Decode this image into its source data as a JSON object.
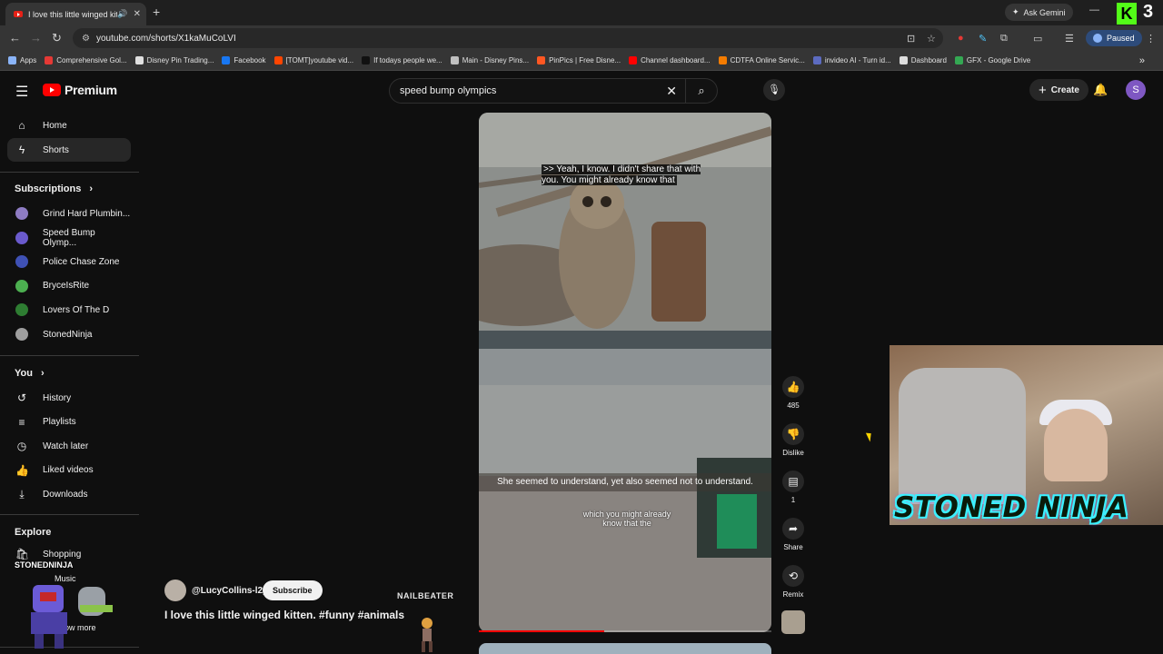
{
  "browser": {
    "tab_title": "I love this little winged kitten",
    "tab_audio_icon": "speaker-icon",
    "url": "youtube.com/shorts/X1kaMuCoLVI",
    "ask_gemini": "Ask Gemini",
    "profile_status": "Paused",
    "kick_number": "3",
    "bookmarks": [
      {
        "label": "Apps",
        "color": "#8ab4f8"
      },
      {
        "label": "Comprehensive Gol...",
        "color": "#e53935"
      },
      {
        "label": "Disney Pin Trading...",
        "color": "#e0e0e0"
      },
      {
        "label": "Facebook",
        "color": "#1877f2"
      },
      {
        "label": "[TOMT]youtube vid...",
        "color": "#ff4500"
      },
      {
        "label": "If todays people we...",
        "color": "#111111"
      },
      {
        "label": "Main - Disney Pins...",
        "color": "#c0c0c0"
      },
      {
        "label": "PinPics | Free Disne...",
        "color": "#ff5722"
      },
      {
        "label": "Channel dashboard...",
        "color": "#ff0000"
      },
      {
        "label": "CDTFA Online Servic...",
        "color": "#f57c00"
      },
      {
        "label": "invideo AI - Turn id...",
        "color": "#5c6bc0"
      },
      {
        "label": "Dashboard",
        "color": "#dddddd"
      },
      {
        "label": "GFX - Google Drive",
        "color": "#34a853"
      }
    ]
  },
  "header": {
    "logo_text": "Premium",
    "search_query": "speed bump olympics",
    "create_label": "Create",
    "avatar_letter": "S"
  },
  "sidebar": {
    "main": [
      {
        "label": "Home",
        "icon": "⌂",
        "active": false
      },
      {
        "label": "Shorts",
        "icon": "ϟ",
        "active": true
      }
    ],
    "subscriptions_title": "Subscriptions",
    "subscriptions": [
      {
        "label": "Grind Hard Plumbin...",
        "color": "#8e7cc3"
      },
      {
        "label": "Speed Bump Olymp...",
        "color": "#6a5acd"
      },
      {
        "label": "Police Chase Zone",
        "color": "#3f51b5"
      },
      {
        "label": "BryceIsRite",
        "color": "#4caf50"
      },
      {
        "label": "Lovers Of The D",
        "color": "#2e7d32"
      },
      {
        "label": "StonedNinja",
        "color": "#9e9e9e"
      }
    ],
    "you_title": "You",
    "you": [
      {
        "label": "History",
        "icon": "↺"
      },
      {
        "label": "Playlists",
        "icon": "≡"
      },
      {
        "label": "Watch later",
        "icon": "◷"
      },
      {
        "label": "Liked videos",
        "icon": "👍"
      },
      {
        "label": "Downloads",
        "icon": "⤓"
      }
    ],
    "explore_title": "Explore",
    "explore": [
      {
        "label": "Shopping",
        "icon": "🛍"
      }
    ]
  },
  "short": {
    "caption_top": ">> Yeah, I know. I didn't share that with you. You might already know that",
    "caption_mid": "She seemed to understand, yet also seemed not to understand.",
    "caption_overlay_1": "which you might already",
    "caption_overlay_2": "know that the",
    "progress": 0.43,
    "likes": "485",
    "dislike_label": "Dislike",
    "comments": "1",
    "share_label": "Share",
    "remix_label": "Remix",
    "channel": "@LucyCollins-l2y",
    "subscribe_label": "Subscribe",
    "title": "I love this little winged kitten. #funny #animals"
  },
  "overlays": {
    "stoned_ninja_banner": "STONED NINJA",
    "stoned_ninja_small": "STONEDNINJA",
    "nailbeater": "NAILBEATER",
    "sidebar_partial_1": "Music",
    "sidebar_partial_2": "Show more"
  }
}
